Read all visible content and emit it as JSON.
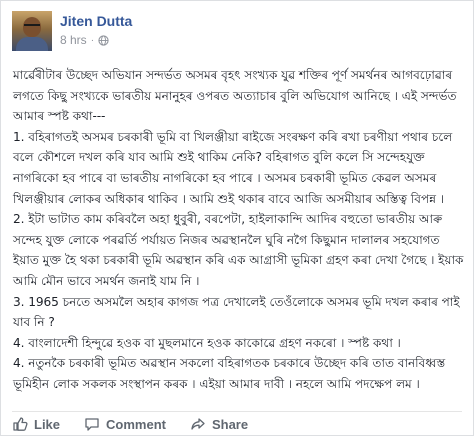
{
  "post": {
    "author": "Jiten Dutta",
    "time": "8 hrs",
    "visibility_icon": "globe-icon",
    "paragraphs": [
      "মাৰ্ৱেৰীটাৰ উচ্ছেদ অভিযান সন্দৰ্ভত অসমৰ বৃহৎ সংখ্যক যুৱ শক্তিৰ পূৰ্ণ সমৰ্থনৰ আগবঢ়োৱাৰ লগতে কিছু সংখ্যকে ভাৰতীয় মনানুহৰ ওপৰত অত্যাচাৰ বুলি অভিযোগ আনিছে । এই সন্দৰ্ভত আমাৰ স্পষ্ট কথা---",
      "1. বহিৰাগতই অসমৰ চৰকাৰী ভূমি বা খিলঞ্জীয়া ৰাইজে সংৰক্ষণ কৰি ৰখা চৰণীয়া পথাৰ চলে বলে কৌশলে দখল কৰি যাব আমি শুই থাকিম নেকি? বহিৰাগত বুলি কলে সি সন্দেহযুক্ত নাগৰিকো হব পাৰে বা ভাৰতীয় নাগৰিকো হব পাৰে । অসমৰ চৰকাৰী ভূমিত কেৱল অসমৰ খিলঞ্জীয়াৰ লোকৰ অধিকাৰ থাকিব । আমি শুই থকাৰ বাবে আজি অসমীয়াৰ অস্তিত্ব বিপন্ন ।",
      "2. ইটা ভাটাত কাম কৰিবলৈ অহা ধুবুৰী, বৰপেটা, হাইলাকান্দি আদিৰ বহুতো ভাৰতীয় আৰু সন্দেহ যুক্ত লোকে পৰৱৰ্তি পৰ্যায়ত নিজৰ অৱস্থানলৈ ঘুৰি নগৈ কিছুমান দালালৰ সহযোগত ইয়াত মুক্ত হৈ থকা চৰকাৰী ভূমি অৱস্থান কৰি এক আগ্ৰাসী ভূমিকা গ্ৰহণ কৰা দেখা গৈছে । ইয়াক আমি মৌন ভাবে সমৰ্থন জনাই যাম নি ।",
      "3. 1965 চনতে অসমলৈ অহাৰ কাগজ পত্ৰ দেখালেই তেওঁলোকে অসমৰ ভূমি দখল কৰাৰ পাই যাব নি ?",
      "4. বাংলাদেশী হিন্দুৱে হওক বা মুছলমানে হওক কাকোৱে গ্ৰহণ নকৰো । স্পষ্ট কথা ।",
      "4. নতুনকৈ চৰকাৰী ভূমিত অৱস্থান সকলো বহিৰাগতক চৰকাৰে উচ্ছেদ কৰি তাত বানবিধ্বস্ত ভূমিহীন লোক সকলক সংস্থাপন কৰক । এইয়া আমাৰ দাবী । নহলে আমি পদক্ষেপ লম ।"
    ]
  },
  "actions": {
    "like_label": "Like",
    "comment_label": "Comment",
    "share_label": "Share",
    "like_icon": "thumbs-up-icon",
    "comment_icon": "comment-bubble-icon",
    "share_icon": "share-arrow-icon"
  },
  "colors": {
    "author_link": "#365899",
    "meta_text": "#90949c",
    "action_text": "#606770"
  }
}
